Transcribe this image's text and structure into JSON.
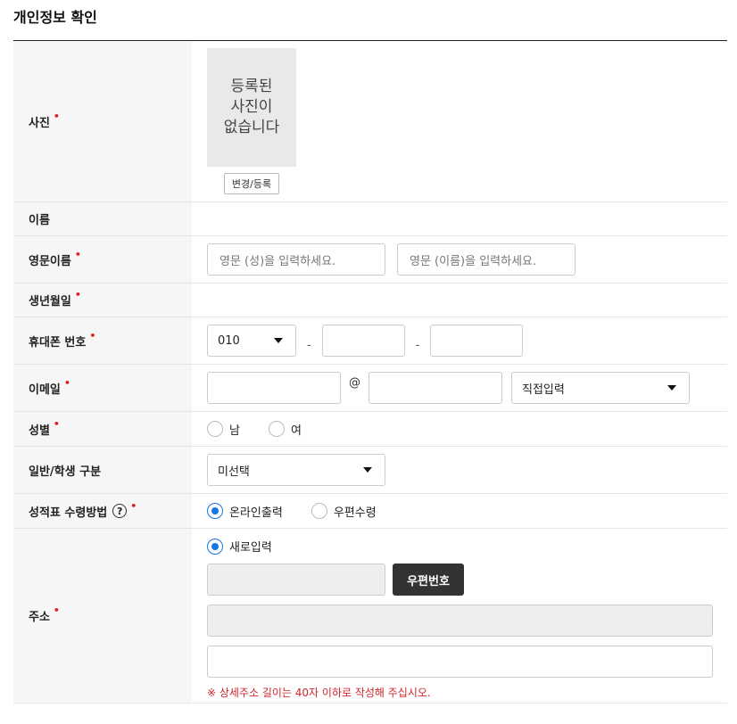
{
  "page": {
    "title": "개인정보 확인"
  },
  "photo": {
    "label": "사진",
    "placeholder_text": "등록된\n사진이\n없습니다",
    "change_button": "변경/등록"
  },
  "name": {
    "label": "이름",
    "value": ""
  },
  "english_name": {
    "label": "영문이름",
    "last_placeholder": "영문 (성)을 입력하세요.",
    "first_placeholder": "영문 (이름)을 입력하세요."
  },
  "birth": {
    "label": "생년월일",
    "value": ""
  },
  "phone": {
    "label": "휴대폰 번호",
    "prefix": "010",
    "dash": "-"
  },
  "email": {
    "label": "이메일",
    "at": "@",
    "domain_select": "직접입력"
  },
  "gender": {
    "label": "성별",
    "options": [
      "남",
      "여"
    ]
  },
  "student_type": {
    "label": "일반/학생 구분",
    "selected": "미선택"
  },
  "report_method": {
    "label": "성적표 수령방법",
    "help_icon_glyph": "?",
    "options": [
      "온라인출력",
      "우편수령"
    ],
    "selected_index": 0
  },
  "address": {
    "label": "주소",
    "new_input_label": "새로입력",
    "postcode_button": "우편번호",
    "note": "※ 상세주소 길이는 40자 이하로 작성해 주십시오."
  },
  "required_mark": "•",
  "colors": {
    "required": "#e02020",
    "radio_active": "#1a73e8",
    "dark_button": "#333333",
    "note": "#d0242a"
  }
}
